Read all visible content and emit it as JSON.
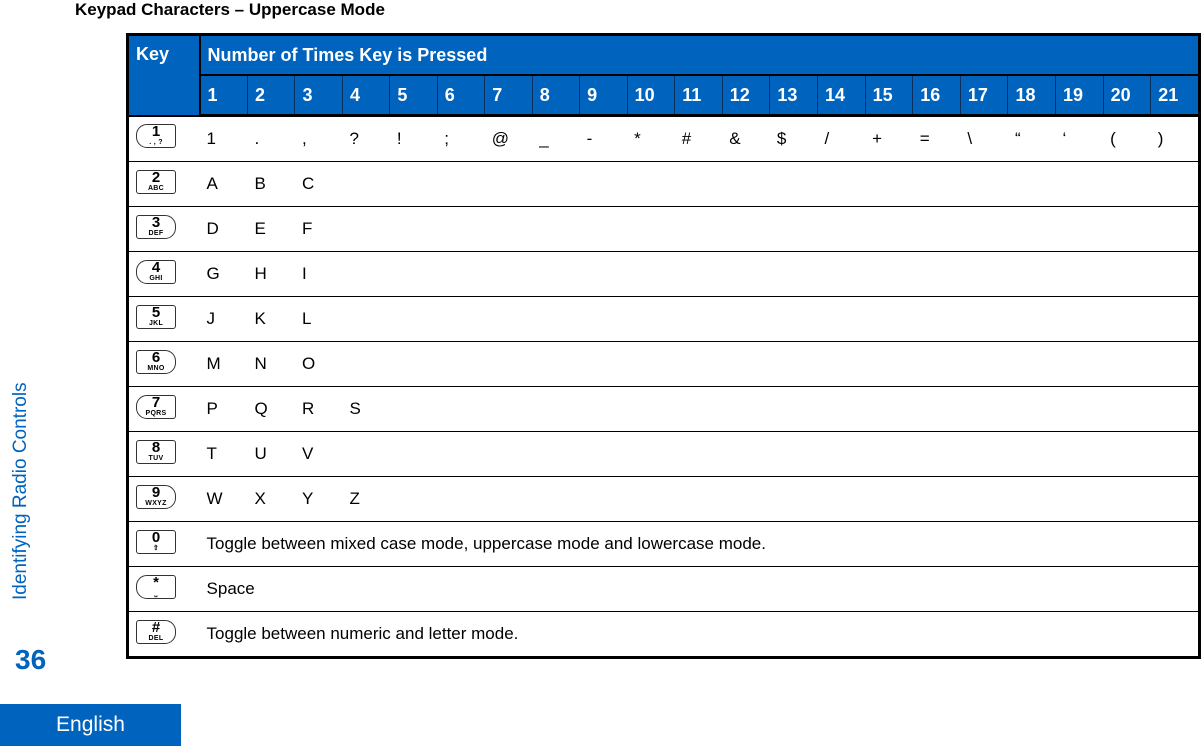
{
  "document": {
    "title": "Keypad Characters – Uppercase Mode",
    "section": "Identifying Radio Controls",
    "page_number": "36",
    "language": "English"
  },
  "table": {
    "header_key": "Key",
    "header_presses": "Number of Times Key is Pressed",
    "press_counts": [
      "1",
      "2",
      "3",
      "4",
      "5",
      "6",
      "7",
      "8",
      "9",
      "10",
      "11",
      "12",
      "13",
      "14",
      "15",
      "16",
      "17",
      "18",
      "19",
      "20",
      "21"
    ],
    "rows": [
      {
        "key": {
          "icon": "key-1-icon",
          "main": "1",
          "sub": ". , ?",
          "shape": "rl"
        },
        "chars": [
          "1",
          ".",
          ",",
          "?",
          "!",
          ";",
          "@",
          "_",
          "-",
          "*",
          "#",
          "&",
          "$",
          "/",
          "+",
          "=",
          "\\",
          "“",
          "‘",
          "(",
          ")"
        ]
      },
      {
        "key": {
          "icon": "key-2-icon",
          "main": "2",
          "sub": "ABC",
          "shape": "sq"
        },
        "chars": [
          "A",
          "B",
          "C"
        ]
      },
      {
        "key": {
          "icon": "key-3-icon",
          "main": "3",
          "sub": "DEF",
          "shape": "rr"
        },
        "chars": [
          "D",
          "E",
          "F"
        ]
      },
      {
        "key": {
          "icon": "key-4-icon",
          "main": "4",
          "sub": "GHI",
          "shape": "rl"
        },
        "chars": [
          "G",
          "H",
          "I"
        ]
      },
      {
        "key": {
          "icon": "key-5-icon",
          "main": "5",
          "sub": "JKL",
          "shape": "sq"
        },
        "chars": [
          "J",
          "K",
          "L"
        ]
      },
      {
        "key": {
          "icon": "key-6-icon",
          "main": "6",
          "sub": "MNO",
          "shape": "rr"
        },
        "chars": [
          "M",
          "N",
          "O"
        ]
      },
      {
        "key": {
          "icon": "key-7-icon",
          "main": "7",
          "sub": "PQRS",
          "shape": "rl"
        },
        "chars": [
          "P",
          "Q",
          "R",
          "S"
        ]
      },
      {
        "key": {
          "icon": "key-8-icon",
          "main": "8",
          "sub": "TUV",
          "shape": "sq"
        },
        "chars": [
          "T",
          "U",
          "V"
        ]
      },
      {
        "key": {
          "icon": "key-9-icon",
          "main": "9",
          "sub": "WXYZ",
          "shape": "rr"
        },
        "chars": [
          "W",
          "X",
          "Y",
          "Z"
        ]
      },
      {
        "key": {
          "icon": "key-0-icon",
          "main": "0",
          "sub": "⇧",
          "shape": "sq"
        },
        "description": "Toggle between mixed case mode, uppercase mode and lowercase mode."
      },
      {
        "key": {
          "icon": "key-star-icon",
          "main": "*",
          "sub": "⎵",
          "shape": "rl"
        },
        "description": "Space"
      },
      {
        "key": {
          "icon": "key-hash-icon",
          "main": "#",
          "sub": "DEL",
          "shape": "rr"
        },
        "description": "Toggle between numeric and letter mode."
      }
    ]
  },
  "colors": {
    "brand_blue": "#0063be"
  }
}
